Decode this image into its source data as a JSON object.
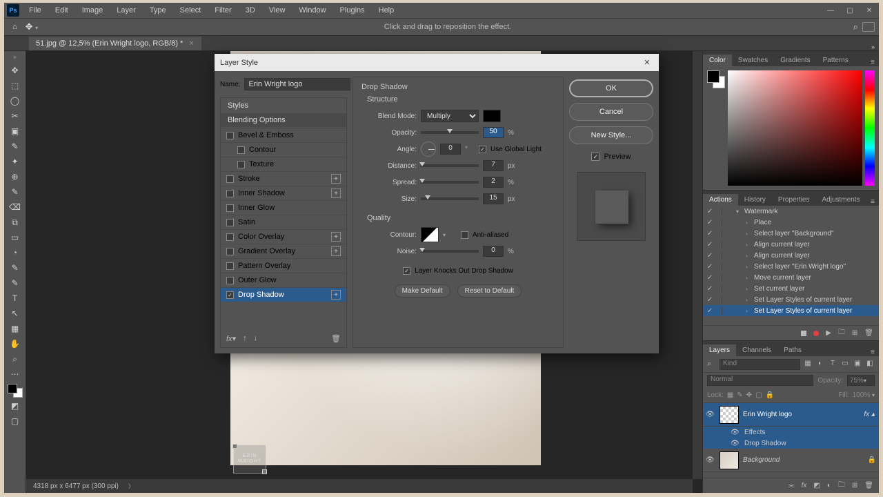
{
  "menubar": [
    "File",
    "Edit",
    "Image",
    "Layer",
    "Type",
    "Select",
    "Filter",
    "3D",
    "View",
    "Window",
    "Plugins",
    "Help"
  ],
  "optbar": {
    "tip": "Click and drag to reposition the effect."
  },
  "tab": {
    "title": "51.jpg @ 12,5% (Erin Wright logo, RGB/8) *"
  },
  "statusbar": {
    "dims": "4318 px x 6477 px (300 ppi)"
  },
  "watermark_text": "ERIN\nWRIGHT",
  "panels": {
    "color_tabs": [
      "Color",
      "Swatches",
      "Gradients",
      "Patterns"
    ],
    "mid_tabs": [
      "Actions",
      "History",
      "Properties",
      "Adjustments"
    ],
    "layer_tabs": [
      "Layers",
      "Channels",
      "Paths"
    ]
  },
  "actions": {
    "set": "Watermark",
    "items": [
      "Place",
      "Select layer \"Background\"",
      "Align current layer",
      "Align current layer",
      "Select layer \"Erin Wright logo\"",
      "Move current layer",
      "Set current layer",
      "Set Layer Styles of current layer",
      "Set Layer Styles of current layer"
    ],
    "selected_index": 8
  },
  "layers": {
    "kind_placeholder": "Kind",
    "blend": "Normal",
    "opacity_label": "Opacity:",
    "opacity_val": "75%",
    "lock_label": "Lock:",
    "fill_label": "Fill:",
    "fill_val": "100%",
    "items": [
      {
        "name": "Erin Wright logo",
        "fx": true,
        "effects": [
          "Effects",
          "Drop Shadow"
        ],
        "selected": true
      },
      {
        "name": "Background",
        "locked": true,
        "italic": true
      }
    ]
  },
  "dialog": {
    "title": "Layer Style",
    "name_label": "Name:",
    "name_value": "Erin Wright logo",
    "styles_header": "Styles",
    "blending_options": "Blending Options",
    "effects": [
      {
        "label": "Bevel & Emboss",
        "checked": false
      },
      {
        "label": "Contour",
        "checked": false,
        "sub": true
      },
      {
        "label": "Texture",
        "checked": false,
        "sub": true
      },
      {
        "label": "Stroke",
        "checked": false,
        "plus": true
      },
      {
        "label": "Inner Shadow",
        "checked": false,
        "plus": true
      },
      {
        "label": "Inner Glow",
        "checked": false
      },
      {
        "label": "Satin",
        "checked": false
      },
      {
        "label": "Color Overlay",
        "checked": false,
        "plus": true
      },
      {
        "label": "Gradient Overlay",
        "checked": false,
        "plus": true
      },
      {
        "label": "Pattern Overlay",
        "checked": false
      },
      {
        "label": "Outer Glow",
        "checked": false
      },
      {
        "label": "Drop Shadow",
        "checked": true,
        "plus": true,
        "selected": true
      }
    ],
    "section": "Drop Shadow",
    "structure": {
      "title": "Structure",
      "blend_mode_label": "Blend Mode:",
      "blend_mode": "Multiply",
      "opacity_label": "Opacity:",
      "opacity": "50",
      "angle_label": "Angle:",
      "angle": "0",
      "angle_unit": "°",
      "global_light": "Use Global Light",
      "distance_label": "Distance:",
      "distance": "7",
      "distance_unit": "px",
      "spread_label": "Spread:",
      "spread": "2",
      "spread_unit": "%",
      "size_label": "Size:",
      "size": "15",
      "size_unit": "px"
    },
    "quality": {
      "title": "Quality",
      "contour_label": "Contour:",
      "antialiased": "Anti-aliased",
      "noise_label": "Noise:",
      "noise": "0",
      "noise_unit": "%"
    },
    "knockout": "Layer Knocks Out Drop Shadow",
    "make_default": "Make Default",
    "reset_default": "Reset to Default",
    "ok": "OK",
    "cancel": "Cancel",
    "new_style": "New Style...",
    "preview": "Preview"
  }
}
